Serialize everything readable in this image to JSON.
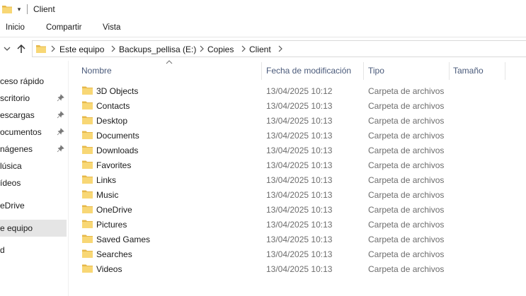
{
  "window": {
    "title": "Client",
    "quick_access_arrow": "▾"
  },
  "ribbon": {
    "tabs": [
      "Inicio",
      "Compartir",
      "Vista"
    ]
  },
  "address": {
    "crumbs": [
      "Este equipo",
      "Backups_pellisa (E:)",
      "Copies",
      "Client"
    ]
  },
  "sidebar": {
    "items": [
      {
        "label": "ceso rápido",
        "pinned": false,
        "selected": false
      },
      {
        "label": "scritorio",
        "pinned": true,
        "selected": false
      },
      {
        "label": "escargas",
        "pinned": true,
        "selected": false
      },
      {
        "label": "ocumentos",
        "pinned": true,
        "selected": false
      },
      {
        "label": "nágenes",
        "pinned": true,
        "selected": false
      },
      {
        "label": "lúsica",
        "pinned": false,
        "selected": false
      },
      {
        "label": "ídeos",
        "pinned": false,
        "selected": false
      },
      {
        "label": "eDrive",
        "pinned": false,
        "selected": false
      },
      {
        "label": "e equipo",
        "pinned": false,
        "selected": true
      },
      {
        "label": "d",
        "pinned": false,
        "selected": false
      }
    ]
  },
  "columns": {
    "name": "Nombre",
    "date": "Fecha de modificación",
    "type": "Tipo",
    "size": "Tamaño",
    "sorted_by": "name"
  },
  "files": [
    {
      "name": "3D Objects",
      "date": "13/04/2025 10:12",
      "type": "Carpeta de archivos"
    },
    {
      "name": "Contacts",
      "date": "13/04/2025 10:13",
      "type": "Carpeta de archivos"
    },
    {
      "name": "Desktop",
      "date": "13/04/2025 10:13",
      "type": "Carpeta de archivos"
    },
    {
      "name": "Documents",
      "date": "13/04/2025 10:13",
      "type": "Carpeta de archivos"
    },
    {
      "name": "Downloads",
      "date": "13/04/2025 10:13",
      "type": "Carpeta de archivos"
    },
    {
      "name": "Favorites",
      "date": "13/04/2025 10:13",
      "type": "Carpeta de archivos"
    },
    {
      "name": "Links",
      "date": "13/04/2025 10:13",
      "type": "Carpeta de archivos"
    },
    {
      "name": "Music",
      "date": "13/04/2025 10:13",
      "type": "Carpeta de archivos"
    },
    {
      "name": "OneDrive",
      "date": "13/04/2025 10:13",
      "type": "Carpeta de archivos"
    },
    {
      "name": "Pictures",
      "date": "13/04/2025 10:13",
      "type": "Carpeta de archivos"
    },
    {
      "name": "Saved Games",
      "date": "13/04/2025 10:13",
      "type": "Carpeta de archivos"
    },
    {
      "name": "Searches",
      "date": "13/04/2025 10:13",
      "type": "Carpeta de archivos"
    },
    {
      "name": "Videos",
      "date": "13/04/2025 10:13",
      "type": "Carpeta de archivos"
    }
  ],
  "colors": {
    "folder_yellow": "#f8d775",
    "folder_dark": "#e6b84a",
    "header_text": "#4a5a7a",
    "selected_bg": "#e5e5e5"
  }
}
